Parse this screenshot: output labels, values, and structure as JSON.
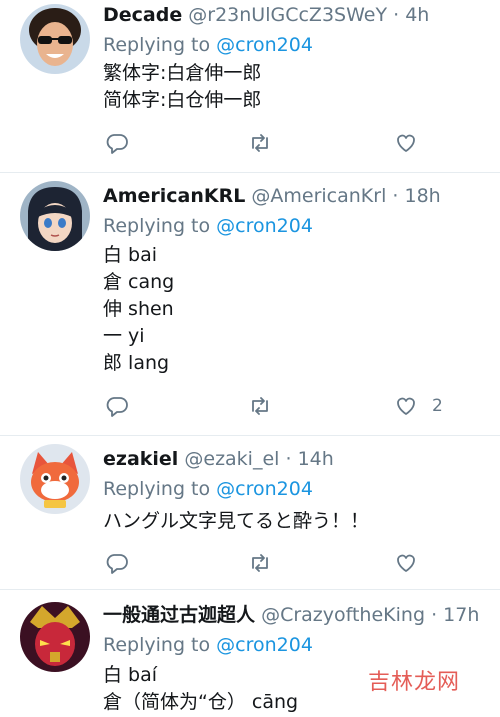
{
  "tweets": [
    {
      "name": "Decade",
      "handle": "@r23nUlGCcZ3SWeY",
      "separator": "·",
      "time": "4h",
      "replying_prefix": "Replying to ",
      "replying_to": "@cron204",
      "lines": [
        "繁体字:白倉伸一郎",
        "简体字:白仓伸一郎"
      ],
      "like_count": ""
    },
    {
      "name": "AmericanKRL",
      "handle": "@AmericanKrl",
      "separator": "·",
      "time": "18h",
      "replying_prefix": "Replying to ",
      "replying_to": "@cron204",
      "lines": [
        "白 bai",
        "倉 cang",
        "伸 shen",
        "一 yi",
        "郎 lang"
      ],
      "like_count": "2"
    },
    {
      "name": "ezakiel",
      "handle": "@ezaki_el",
      "separator": "·",
      "time": "14h",
      "replying_prefix": "Replying to ",
      "replying_to": "@cron204",
      "lines": [
        "ハングル文字見てると酔う！！"
      ],
      "like_count": ""
    },
    {
      "name": "一般通过古迦超人",
      "handle": "@CrazyoftheKing",
      "separator": "·",
      "time": "17h",
      "replying_prefix": "Replying to ",
      "replying_to": "@cron204",
      "lines": [
        "白 baí",
        "倉（简体为“仓） cāng"
      ],
      "like_count": ""
    }
  ],
  "icons": {
    "reply": "reply-icon",
    "retweet": "retweet-icon",
    "like": "like-icon"
  },
  "colors": {
    "name": "#14171a",
    "muted": "#657786",
    "mention": "#1b95e0",
    "divider": "#e6ecf0"
  },
  "watermark": "吉林龙网"
}
